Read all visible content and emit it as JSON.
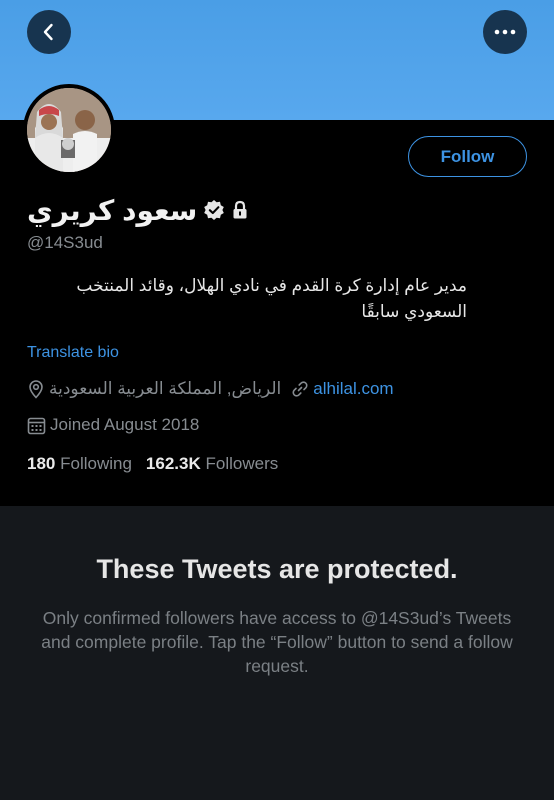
{
  "banner": {
    "color": "#4a9ee6"
  },
  "nav": {
    "back_icon": "chevron-left-icon",
    "more_icon": "ellipsis-icon"
  },
  "profile": {
    "name": "سعود كريري",
    "handle": "@14S3ud",
    "follow_label": "Follow",
    "bio": "مدير عام إدارة كرة القدم في نادي الهلال، وقائد المنتخب السعودي سابقًا",
    "translate_label": "Translate bio",
    "location": "الرياض, المملكة العربية السعودية",
    "website": "alhilal.com",
    "joined": "Joined August 2018",
    "following_count": "180",
    "following_label": "Following",
    "followers_count": "162.3K",
    "followers_label": "Followers"
  },
  "protected": {
    "title": "These Tweets are protected.",
    "body": "Only confirmed followers have access to @14S3ud’s Tweets and complete profile. Tap the “Follow” button to send a follow request."
  },
  "colors": {
    "accent": "#3d93e3",
    "background": "#000000",
    "panel": "#15181c"
  }
}
